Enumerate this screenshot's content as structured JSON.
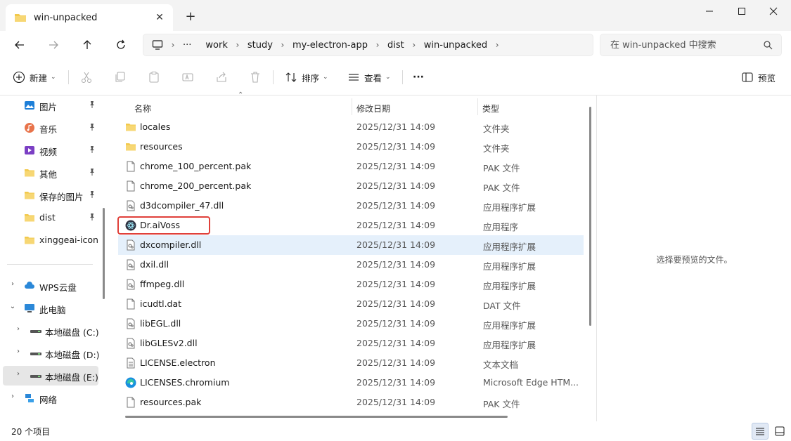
{
  "window": {
    "tab_title": "win-unpacked",
    "new_tab_symbol": "+",
    "close_tab_symbol": "✕"
  },
  "address": {
    "more_symbol": "···",
    "breadcrumbs": [
      "work",
      "study",
      "my-electron-app",
      "dist",
      "win-unpacked"
    ],
    "search_placeholder": "在 win-unpacked 中搜索"
  },
  "toolbar": {
    "new_label": "新建",
    "sort_label": "排序",
    "view_label": "查看",
    "more_label": "···",
    "preview_label": "预览",
    "icons": [
      "cut-icon",
      "copy-icon",
      "paste-icon",
      "rename-icon",
      "share-icon",
      "delete-icon"
    ]
  },
  "sidebar": {
    "quick_access": [
      {
        "label": "图片",
        "icon": "pictures-icon",
        "color": "#1e7fd8"
      },
      {
        "label": "音乐",
        "icon": "music-icon",
        "color": "#e8734a"
      },
      {
        "label": "视频",
        "icon": "videos-icon",
        "color": "#7b3fc4"
      },
      {
        "label": "其他",
        "icon": "folder-icon",
        "color": "#f2c94c"
      },
      {
        "label": "保存的图片",
        "icon": "folder-icon",
        "color": "#f2c94c"
      },
      {
        "label": "dist",
        "icon": "folder-icon",
        "color": "#f2c94c"
      },
      {
        "label": "xinggeai-icon",
        "icon": "folder-icon",
        "color": "#f2c94c"
      }
    ],
    "locations": [
      {
        "label": "WPS云盘",
        "icon": "cloud-icon",
        "expander": "›"
      },
      {
        "label": "此电脑",
        "icon": "computer-icon",
        "expander": "⌄"
      },
      {
        "label": "本地磁盘 (C:)",
        "icon": "drive-icon",
        "expander": "›"
      },
      {
        "label": "本地磁盘 (D:)",
        "icon": "drive-icon",
        "expander": "›"
      },
      {
        "label": "本地磁盘 (E:)",
        "icon": "drive-icon",
        "expander": "›",
        "selected": true
      },
      {
        "label": "网络",
        "icon": "network-icon",
        "expander": "›"
      }
    ]
  },
  "columns": {
    "name": "名称",
    "date": "修改日期",
    "type": "类型"
  },
  "files": [
    {
      "name": "locales",
      "date": "2025/12/31 14:09",
      "type": "文件夹",
      "icon": "folder-icon"
    },
    {
      "name": "resources",
      "date": "2025/12/31 14:09",
      "type": "文件夹",
      "icon": "folder-icon"
    },
    {
      "name": "chrome_100_percent.pak",
      "date": "2025/12/31 14:09",
      "type": "PAK 文件",
      "icon": "file-icon"
    },
    {
      "name": "chrome_200_percent.pak",
      "date": "2025/12/31 14:09",
      "type": "PAK 文件",
      "icon": "file-icon"
    },
    {
      "name": "d3dcompiler_47.dll",
      "date": "2025/12/31 14:09",
      "type": "应用程序扩展",
      "icon": "dll-icon"
    },
    {
      "name": "Dr.aiVoss",
      "date": "2025/12/31 14:09",
      "type": "应用程序",
      "icon": "electron-app-icon"
    },
    {
      "name": "dxcompiler.dll",
      "date": "2025/12/31 14:09",
      "type": "应用程序扩展",
      "icon": "dll-icon",
      "selected": true
    },
    {
      "name": "dxil.dll",
      "date": "2025/12/31 14:09",
      "type": "应用程序扩展",
      "icon": "dll-icon"
    },
    {
      "name": "ffmpeg.dll",
      "date": "2025/12/31 14:09",
      "type": "应用程序扩展",
      "icon": "dll-icon"
    },
    {
      "name": "icudtl.dat",
      "date": "2025/12/31 14:09",
      "type": "DAT 文件",
      "icon": "file-icon"
    },
    {
      "name": "libEGL.dll",
      "date": "2025/12/31 14:09",
      "type": "应用程序扩展",
      "icon": "dll-icon"
    },
    {
      "name": "libGLESv2.dll",
      "date": "2025/12/31 14:09",
      "type": "应用程序扩展",
      "icon": "dll-icon"
    },
    {
      "name": "LICENSE.electron",
      "date": "2025/12/31 14:09",
      "type": "文本文档",
      "icon": "text-file-icon"
    },
    {
      "name": "LICENSES.chromium",
      "date": "2025/12/31 14:09",
      "type": "Microsoft Edge HTM...",
      "icon": "edge-icon"
    },
    {
      "name": "resources.pak",
      "date": "2025/12/31 14:09",
      "type": "PAK 文件",
      "icon": "file-icon"
    }
  ],
  "preview": {
    "empty_text": "选择要预览的文件。"
  },
  "status": {
    "item_count": "20 个项目"
  },
  "colors": {
    "accent": "#0067c0",
    "selection": "#e5f0fb",
    "highlight_border": "#e0403a",
    "folder": "#f2c94c"
  }
}
